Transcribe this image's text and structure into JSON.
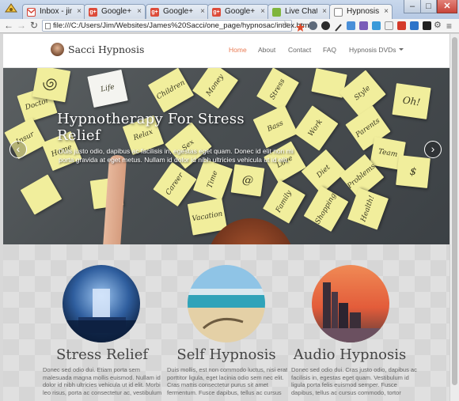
{
  "browser": {
    "tabs": [
      {
        "title": "Inbox - jim.sacc",
        "favicon": "gmail-icon",
        "color": "#d44638"
      },
      {
        "title": "Google+",
        "favicon": "google-plus-icon",
        "color": "#dd4b39"
      },
      {
        "title": "Google+",
        "favicon": "google-plus-icon",
        "color": "#dd4b39"
      },
      {
        "title": "Google+",
        "favicon": "google-plus-icon",
        "color": "#dd4b39"
      },
      {
        "title": "Live Chat Softw",
        "favicon": "chat-icon",
        "color": "#7fb53c"
      },
      {
        "title": "Hypnosis Techn",
        "favicon": "page-icon",
        "color": "#ffffff"
      }
    ],
    "active_tab": 5,
    "url": "file:///C:/Users/Jim/Websites/James%20Sacci/one_page/hypnosac/index.html",
    "window_controls": {
      "minimize": "–",
      "maximize": "□",
      "close": "✕"
    }
  },
  "site": {
    "brand": "Sacci Hypnosis",
    "nav": [
      {
        "label": "Home",
        "active": true
      },
      {
        "label": "About",
        "active": false
      },
      {
        "label": "Contact",
        "active": false
      },
      {
        "label": "FAQ",
        "active": false
      },
      {
        "label": "Hypnosis DVDs",
        "active": false,
        "dropdown": true
      }
    ],
    "accent_color": "#e97a52"
  },
  "hero": {
    "title": "Hypnotherapy For Stress Relief",
    "text": "Duis justo odio, dapibus ac facilisis in, egestas eget quam. Donec id elit non mi porta gravida at eget metus. Nullam id dolor id nibh ultricies vehicula ut id elit.",
    "notes": [
      "Life",
      "Doctor",
      "Children",
      "Money",
      "Stress",
      "Style",
      "Oh!",
      "Home",
      "Relax",
      "Sex",
      "Bass",
      "Work",
      "Parents",
      "Team",
      "Love",
      "Diet",
      "Problems",
      "$",
      "Career",
      "Time",
      "@",
      "Family",
      "Shopping",
      "Health!",
      "Vacation",
      "Insur"
    ],
    "prev_label": "‹",
    "next_label": "›"
  },
  "features": [
    {
      "title": "Stress Relief",
      "image": "waterfall-image",
      "text": "Donec sed odio dui. Etiam porta sem malesuada magna mollis euismod. Nullam id dolor id nibh ultricies vehicula ut id elit. Morbi leo risus, porta ac consectetur ac, vestibulum"
    },
    {
      "title": "Self Hypnosis",
      "image": "beach-image",
      "text": "Duis mollis, est non commodo luctus, nisi erat porttitor ligula, eget lacinia odio sem nec elit. Cras mattis consectetur purus sit amet fermentum. Fusce dapibus, tellus ac cursus"
    },
    {
      "title": "Audio Hypnosis",
      "image": "city-sunset-image",
      "text": "Donec sed odio dui. Cras justo odio, dapibus ac facilisis in, egestas eget quam. Vestibulum id ligula porta felis euismod semper. Fusce dapibus, tellus ac cursus commodo, tortor"
    }
  ]
}
